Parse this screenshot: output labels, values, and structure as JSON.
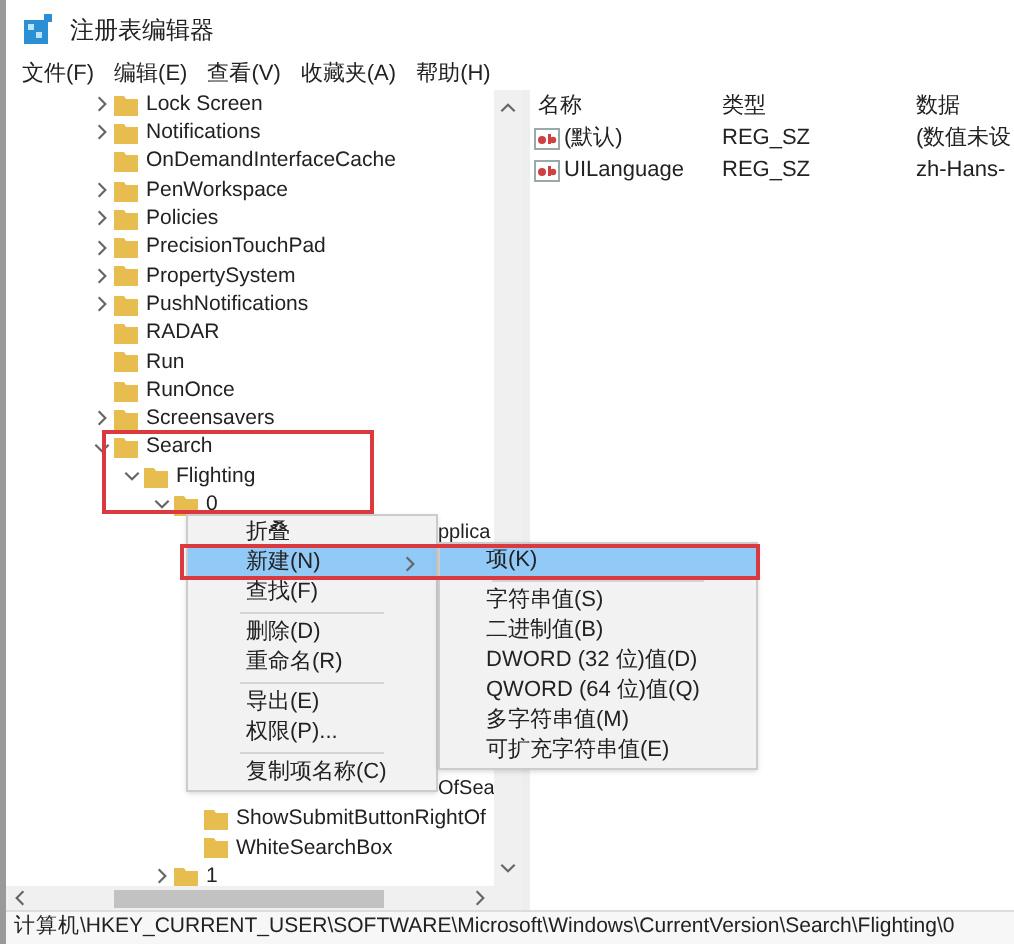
{
  "window": {
    "title": "注册表编辑器"
  },
  "menu_bar": [
    "文件(F)",
    "编辑(E)",
    "查看(V)",
    "收藏夹(A)",
    "帮助(H)"
  ],
  "tree": {
    "items": [
      {
        "kind": "folder",
        "label": "Lock Screen",
        "expandable": true,
        "expanded": false
      },
      {
        "kind": "folder",
        "label": "Notifications",
        "expandable": true,
        "expanded": false
      },
      {
        "kind": "folder",
        "label": "OnDemandInterfaceCache",
        "expandable": false
      },
      {
        "kind": "folder",
        "label": "PenWorkspace",
        "expandable": true,
        "expanded": false
      },
      {
        "kind": "folder",
        "label": "Policies",
        "expandable": true,
        "expanded": false
      },
      {
        "kind": "folder",
        "label": "PrecisionTouchPad",
        "expandable": true,
        "expanded": false
      },
      {
        "kind": "folder",
        "label": "PropertySystem",
        "expandable": true,
        "expanded": false
      },
      {
        "kind": "folder",
        "label": "PushNotifications",
        "expandable": true,
        "expanded": false
      },
      {
        "kind": "folder",
        "label": "RADAR",
        "expandable": false
      },
      {
        "kind": "folder",
        "label": "Run",
        "expandable": false
      },
      {
        "kind": "folder",
        "label": "RunOnce",
        "expandable": false
      },
      {
        "kind": "folder",
        "label": "Screensavers",
        "expandable": true,
        "expanded": false
      },
      {
        "kind": "folder",
        "label": "Search",
        "expandable": true,
        "expanded": true,
        "children": [
          {
            "kind": "folder",
            "label": "Flighting",
            "expandable": true,
            "expanded": true,
            "children": [
              {
                "kind": "folder",
                "label": "0",
                "expandable": true,
                "expanded": true,
                "children": [
                  {
                    "kind": "covered-top",
                    "label": "pplica"
                  },
                  {
                    "kind": "covered-bottom",
                    "label": "OfSea"
                  },
                  {
                    "kind": "folder",
                    "label": "ShowSubmitButtonRightOf",
                    "expandable": false
                  },
                  {
                    "kind": "folder",
                    "label": "WhiteSearchBox",
                    "expandable": false
                  }
                ]
              },
              {
                "kind": "folder",
                "label": "1",
                "expandable": true,
                "expanded": false
              }
            ]
          }
        ]
      }
    ]
  },
  "values": {
    "columns": [
      "名称",
      "类型",
      "数据"
    ],
    "rows": [
      {
        "name": "(默认)",
        "type": "REG_SZ",
        "data": "(数值未设"
      },
      {
        "name": "UILanguage",
        "type": "REG_SZ",
        "data": "zh-Hans-"
      }
    ]
  },
  "context_menu": {
    "items": [
      {
        "kind": "item",
        "label": "折叠",
        "selected": false
      },
      {
        "kind": "submenu",
        "label": "新建(N)",
        "selected": true
      },
      {
        "kind": "item",
        "label": "查找(F)",
        "selected": false
      },
      {
        "kind": "separator"
      },
      {
        "kind": "item",
        "label": "删除(D)",
        "selected": false
      },
      {
        "kind": "item",
        "label": "重命名(R)",
        "selected": false
      },
      {
        "kind": "separator"
      },
      {
        "kind": "item",
        "label": "导出(E)",
        "selected": false
      },
      {
        "kind": "item",
        "label": "权限(P)...",
        "selected": false
      },
      {
        "kind": "separator"
      },
      {
        "kind": "item",
        "label": "复制项名称(C)",
        "selected": false
      }
    ]
  },
  "submenu": {
    "items": [
      {
        "kind": "item",
        "label": "项(K)",
        "selected": true
      },
      {
        "kind": "separator"
      },
      {
        "kind": "item",
        "label": "字符串值(S)",
        "selected": false
      },
      {
        "kind": "item",
        "label": "二进制值(B)",
        "selected": false
      },
      {
        "kind": "item",
        "label": "DWORD (32 位)值(D)",
        "selected": false
      },
      {
        "kind": "item",
        "label": "QWORD (64 位)值(Q)",
        "selected": false
      },
      {
        "kind": "item",
        "label": "多字符串值(M)",
        "selected": false
      },
      {
        "kind": "item",
        "label": "可扩充字符串值(E)",
        "selected": false
      }
    ]
  },
  "status_bar": "计算机\\HKEY_CURRENT_USER\\SOFTWARE\\Microsoft\\Windows\\CurrentVersion\\Search\\Flighting\\0"
}
